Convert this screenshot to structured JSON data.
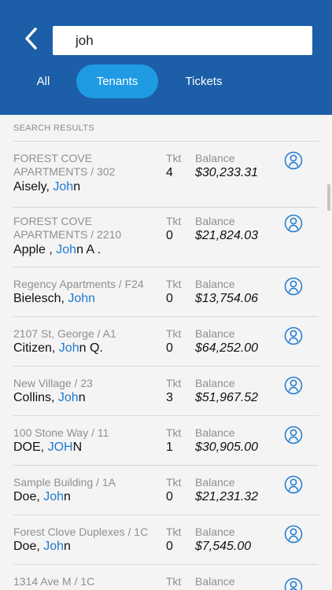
{
  "search": {
    "value": "joh"
  },
  "tabs": [
    {
      "label": "All",
      "active": false
    },
    {
      "label": "Tenants",
      "active": true
    },
    {
      "label": "Tickets",
      "active": false
    }
  ],
  "results_header": "SEARCH RESULTS",
  "labels": {
    "tkt": "Tkt",
    "balance": "Balance"
  },
  "results": [
    {
      "location": "FOREST COVE APARTMENTS / 302",
      "name_pre": "Aisely, ",
      "name_hl": "Joh",
      "name_post": "n",
      "tkt": "4",
      "balance": "$30,233.31"
    },
    {
      "location": "FOREST COVE APARTMENTS / 2210",
      "name_pre": "Apple , ",
      "name_hl": "Joh",
      "name_post": "n A .",
      "tkt": "0",
      "balance": "$21,824.03"
    },
    {
      "location": "Regency Apartments / F24",
      "name_pre": "Bielesch, ",
      "name_hl": "John",
      "name_post": "",
      "tkt": "0",
      "balance": "$13,754.06"
    },
    {
      "location": "2107 St, George / A1",
      "name_pre": "Citizen, ",
      "name_hl": "Joh",
      "name_post": "n Q.",
      "tkt": "0",
      "balance": "$64,252.00"
    },
    {
      "location": "New Village / 23",
      "name_pre": "Collins, ",
      "name_hl": "Joh",
      "name_post": "n",
      "tkt": "3",
      "balance": "$51,967.52"
    },
    {
      "location": "100 Stone Way / 11",
      "name_pre": "DOE, ",
      "name_hl": "JOH",
      "name_post": "N",
      "tkt": "1",
      "balance": "$30,905.00"
    },
    {
      "location": "Sample Building / 1A",
      "name_pre": "Doe, ",
      "name_hl": "Joh",
      "name_post": "n",
      "tkt": "0",
      "balance": "$21,231.32"
    },
    {
      "location": "Forest Clove Duplexes / 1C",
      "name_pre": "Doe, ",
      "name_hl": "Joh",
      "name_post": "n",
      "tkt": "0",
      "balance": "$7,545.00"
    },
    {
      "location": "1314 Ave M / 1C",
      "name_pre": "",
      "name_hl": "",
      "name_post": "",
      "tkt": "",
      "balance": ""
    }
  ],
  "icons": {
    "back": "chevron-left-icon",
    "person": "user-circle-icon"
  },
  "colors": {
    "header": "#1c5ea8",
    "active_tab": "#1f9be3",
    "highlight": "#1f7ad0",
    "background": "#f4f4f4"
  }
}
